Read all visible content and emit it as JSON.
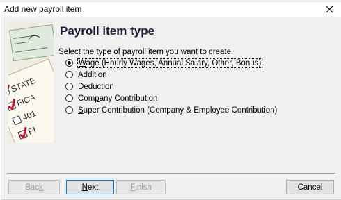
{
  "window": {
    "title": "Add new payroll item",
    "close_glyph": "✕"
  },
  "page": {
    "heading": "Payroll item type",
    "instruction": "Select the type of payroll item you want to create."
  },
  "illustration": {
    "labels": [
      "STATE",
      "FICA",
      "401",
      "FI"
    ]
  },
  "options": [
    {
      "mnemonic": "W",
      "rest": "age (Hourly Wages, Annual Salary, Other, Bonus)",
      "prefix": "",
      "selected": true
    },
    {
      "mnemonic": "A",
      "rest": "ddition",
      "prefix": "",
      "selected": false
    },
    {
      "mnemonic": "D",
      "rest": "eduction",
      "prefix": "",
      "selected": false
    },
    {
      "mnemonic": "p",
      "rest": "any Contribution",
      "prefix": "Com",
      "selected": false
    },
    {
      "mnemonic": "S",
      "rest": "uper Contribution (Company & Employee Contribution)",
      "prefix": "",
      "selected": false
    }
  ],
  "buttons": {
    "back": {
      "prefix": "Bac",
      "mnemonic": "k",
      "rest": "",
      "enabled": false
    },
    "next": {
      "prefix": "",
      "mnemonic": "N",
      "rest": "ext",
      "enabled": true
    },
    "finish": {
      "prefix": "",
      "mnemonic": "F",
      "rest": "inish",
      "enabled": false
    },
    "cancel": {
      "label": "Cancel",
      "enabled": true
    }
  },
  "colors": {
    "heading": "#1b1b3a",
    "checkmark": "#c8102e",
    "default_button_border": "#0078d7"
  }
}
